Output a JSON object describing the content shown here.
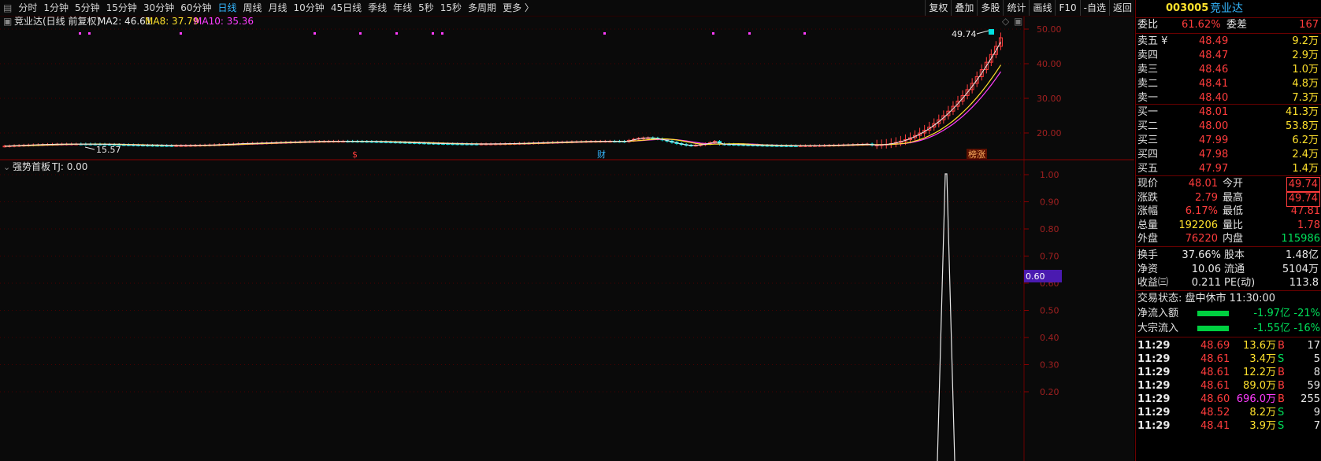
{
  "toolbar": {
    "periods": [
      "分时",
      "1分钟",
      "5分钟",
      "15分钟",
      "30分钟",
      "60分钟",
      "日线",
      "周线",
      "月线",
      "10分钟",
      "45日线",
      "季线",
      "年线",
      "5秒",
      "15秒",
      "多周期",
      "更多 〉"
    ],
    "active_index": 6,
    "right_buttons": [
      "复权",
      "叠加",
      "多股",
      "统计",
      "画线",
      "F10",
      "-自选",
      "返回"
    ]
  },
  "main_chart": {
    "title": "竞业达(日线 前复权)",
    "ma2": "MA2: 46.61",
    "ma8": "MA8: 37.79",
    "ma10": "MA10: 35.36",
    "y_ticks": [
      "50.00",
      "40.00",
      "30.00",
      "20.00"
    ],
    "high_label": "49.74",
    "low_label": "15.57",
    "markers": [
      "$",
      "财",
      "榜涨"
    ],
    "colors": {
      "ma2": "#e8e8e8",
      "ma8": "#ffe12c",
      "ma10": "#ff3cff",
      "up": "#ff3c3c",
      "down": "#00e0e0",
      "grid": "#5a0000"
    }
  },
  "indicator": {
    "title": "强势首板",
    "tj": "TJ: 0.00",
    "y_ticks": [
      "1.00",
      "0.90",
      "0.80",
      "0.70",
      "0.60",
      "0.50",
      "0.40",
      "0.30",
      "0.20"
    ],
    "cursor_label": "0.60"
  },
  "quote": {
    "code": "003005",
    "name": "竞业达",
    "weibi_label": "委比",
    "weibi": "61.62%",
    "weicha_label": "委差",
    "weicha": "167",
    "asks": [
      {
        "label": "卖五 ¥",
        "price": "48.49",
        "vol": "9.2万"
      },
      {
        "label": "卖四",
        "price": "48.47",
        "vol": "2.9万"
      },
      {
        "label": "卖三",
        "price": "48.46",
        "vol": "1.0万"
      },
      {
        "label": "卖二",
        "price": "48.41",
        "vol": "4.8万"
      },
      {
        "label": "卖一",
        "price": "48.40",
        "vol": "7.3万"
      }
    ],
    "bids": [
      {
        "label": "买一",
        "price": "48.01",
        "vol": "41.3万"
      },
      {
        "label": "买二",
        "price": "48.00",
        "vol": "53.8万"
      },
      {
        "label": "买三",
        "price": "47.99",
        "vol": "6.2万"
      },
      {
        "label": "买四",
        "price": "47.98",
        "vol": "2.4万"
      },
      {
        "label": "买五",
        "price": "47.97",
        "vol": "1.4万"
      }
    ],
    "stats": [
      {
        "l1": "现价",
        "v1": "48.01",
        "c1": "red",
        "l2": "今开",
        "v2": "49.74",
        "c2": "red",
        "box2": true
      },
      {
        "l1": "涨跌",
        "v1": "2.79",
        "c1": "red",
        "l2": "最高",
        "v2": "49.74",
        "c2": "red",
        "box2": true
      },
      {
        "l1": "涨幅",
        "v1": "6.17%",
        "c1": "red",
        "l2": "最低",
        "v2": "47.81",
        "c2": "red",
        "box2": false
      },
      {
        "l1": "总量",
        "v1": "192206",
        "c1": "yellow",
        "l2": "量比",
        "v2": "1.78",
        "c2": "red",
        "box2": false
      },
      {
        "l1": "外盘",
        "v1": "76220",
        "c1": "red",
        "l2": "内盘",
        "v2": "115986",
        "c2": "green",
        "box2": false
      }
    ],
    "stats2": [
      {
        "l1": "换手",
        "v1": "37.66%",
        "l2": "股本",
        "v2": "1.48亿"
      },
      {
        "l1": "净资",
        "v1": "10.06",
        "l2": "流通",
        "v2": "5104万"
      },
      {
        "l1": "收益㈢",
        "v1": "0.211",
        "l2": "PE(动)",
        "v2": "113.8"
      }
    ],
    "trade_status": "交易状态: 盘中休市 11:30:00",
    "flows": [
      {
        "label": "净流入额",
        "val": "-1.97亿",
        "pct": "-21%"
      },
      {
        "label": "大宗流入",
        "val": "-1.55亿",
        "pct": "-16%"
      }
    ],
    "ticks": [
      {
        "time": "11:29",
        "price": "48.69",
        "vol": "13.6万",
        "side": "B",
        "count": "17",
        "vcolor": "yellow"
      },
      {
        "time": "11:29",
        "price": "48.61",
        "vol": "3.4万",
        "side": "S",
        "count": "5",
        "vcolor": "yellow"
      },
      {
        "time": "11:29",
        "price": "48.61",
        "vol": "12.2万",
        "side": "B",
        "count": "8",
        "vcolor": "yellow"
      },
      {
        "time": "11:29",
        "price": "48.61",
        "vol": "89.0万",
        "side": "B",
        "count": "59",
        "vcolor": "yellow"
      },
      {
        "time": "11:29",
        "price": "48.60",
        "vol": "696.0万",
        "side": "B",
        "count": "255",
        "vcolor": "magenta"
      },
      {
        "time": "11:29",
        "price": "48.52",
        "vol": "8.2万",
        "side": "S",
        "count": "9",
        "vcolor": "yellow"
      },
      {
        "time": "11:29",
        "price": "48.41",
        "vol": "3.9万",
        "side": "S",
        "count": "7",
        "vcolor": "yellow"
      }
    ]
  }
}
